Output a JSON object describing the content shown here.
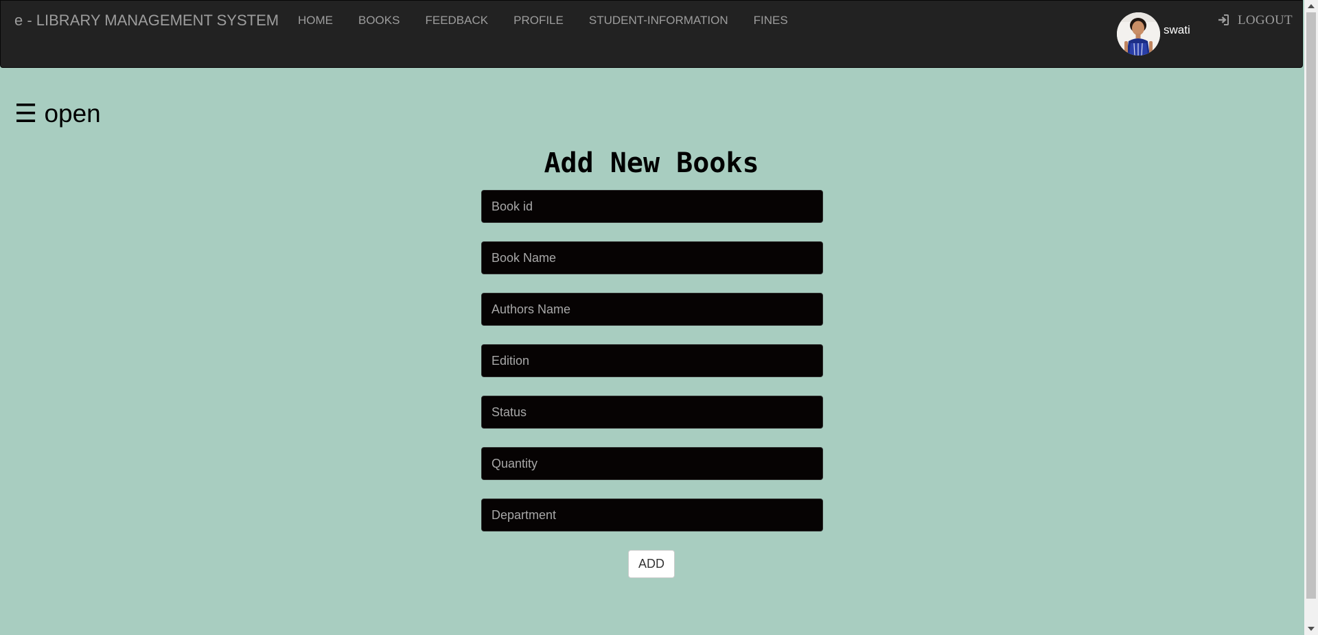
{
  "navbar": {
    "brand": "e - LIBRARY MANAGEMENT SYSTEM",
    "links": [
      "HOME",
      "BOOKS",
      "FEEDBACK",
      "PROFILE",
      "STUDENT-INFORMATION",
      "FINES"
    ],
    "user_name": "swati",
    "logout_label": "LOGOUT"
  },
  "sidebar_toggle": {
    "icon": "☰",
    "label": "open"
  },
  "form": {
    "title": "Add New Books",
    "fields": {
      "book_id": {
        "placeholder": "Book id",
        "value": ""
      },
      "book_name": {
        "placeholder": "Book Name",
        "value": ""
      },
      "authors_name": {
        "placeholder": "Authors Name",
        "value": ""
      },
      "edition": {
        "placeholder": "Edition",
        "value": ""
      },
      "status": {
        "placeholder": "Status",
        "value": ""
      },
      "quantity": {
        "placeholder": "Quantity",
        "value": ""
      },
      "department": {
        "placeholder": "Department",
        "value": ""
      }
    },
    "submit_label": "ADD"
  },
  "colors": {
    "page_background": "#a8cdc0",
    "navbar_background": "#222222",
    "navbar_text": "#9d9d9d",
    "input_background": "#060303",
    "input_placeholder": "#a8a8a8"
  },
  "icons": {
    "menu": "hamburger-icon",
    "logout": "log-in-arrow-icon",
    "avatar": "user-photo-avatar"
  }
}
